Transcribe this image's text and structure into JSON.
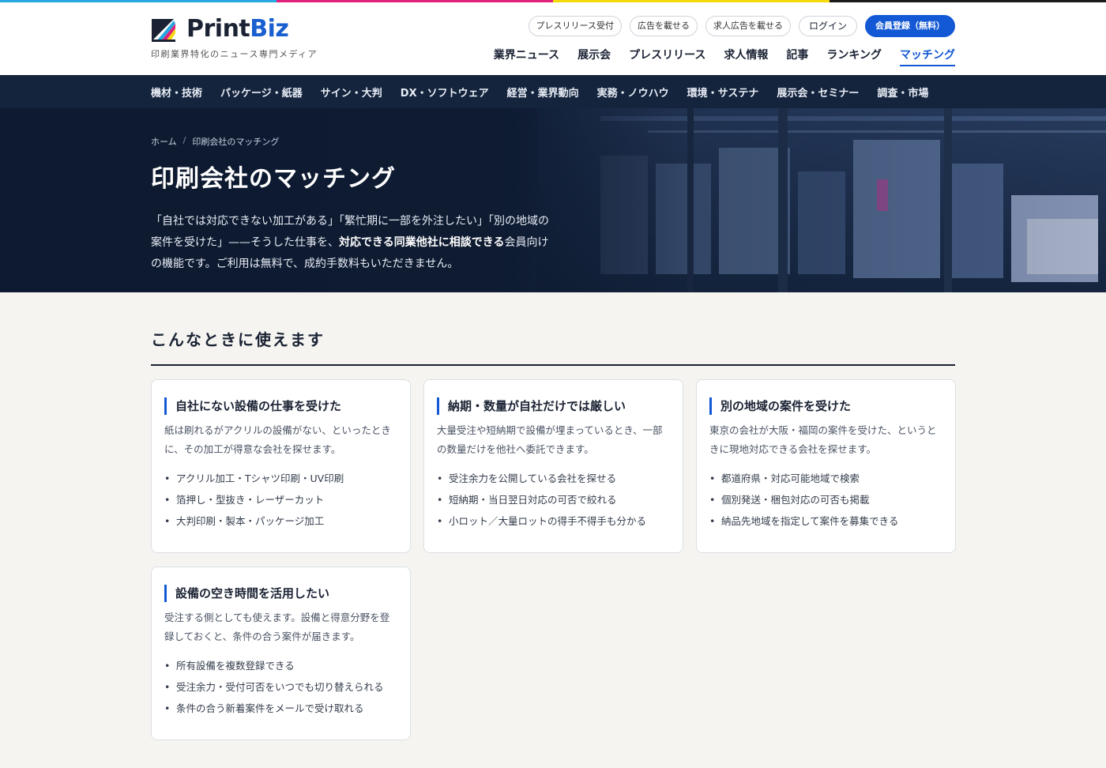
{
  "cmyk_colors": [
    "#27a8e0",
    "#e0207b",
    "#f5d90a",
    "#1a1a1a"
  ],
  "brand": {
    "name_part1": "Print",
    "name_part2": "Biz",
    "tagline": "印刷業界特化のニュース専門メディア",
    "accent": "#1358d4",
    "logo_icon": "printbiz-logo-mark"
  },
  "utility": {
    "press_release": "プレスリリース受付",
    "ads": "広告を載せる",
    "job_ads": "求人広告を載せる",
    "login": "ログイン",
    "register": "会員登録（無料）"
  },
  "main_nav": [
    {
      "label": "業界ニュース",
      "active": false
    },
    {
      "label": "展示会",
      "active": false
    },
    {
      "label": "プレスリリース",
      "active": false
    },
    {
      "label": "求人情報",
      "active": false
    },
    {
      "label": "記事",
      "active": false
    },
    {
      "label": "ランキング",
      "active": false
    },
    {
      "label": "マッチング",
      "active": true
    }
  ],
  "categories": [
    "機材・技術",
    "パッケージ・紙器",
    "サイン・大判",
    "DX・ソフトウェア",
    "経営・業界動向",
    "実務・ノウハウ",
    "環境・サステナ",
    "展示会・セミナー",
    "調査・市場"
  ],
  "hero": {
    "breadcrumb_home": "ホーム",
    "breadcrumb_sep": "/",
    "breadcrumb_current": "印刷会社のマッチング",
    "title": "印刷会社のマッチング",
    "desc_before": "「自社では対応できない加工がある」「繁忙期に一部を外注したい」「別の地域の案件を受けた」——そうした仕事を、",
    "desc_bold": "対応できる同業他社に相談できる",
    "desc_after": "会員向けの機能です。ご利用は無料で、成約手数料もいただきません。"
  },
  "section": {
    "heading": "こんなときに使えます",
    "cards": [
      {
        "title": "自社にない設備の仕事を受けた",
        "desc": "紙は刷れるがアクリルの設備がない、といったときに、その加工が得意な会社を探せます。",
        "items": [
          "アクリル加工・Tシャツ印刷・UV印刷",
          "箔押し・型抜き・レーザーカット",
          "大判印刷・製本・パッケージ加工"
        ]
      },
      {
        "title": "納期・数量が自社だけでは厳しい",
        "desc": "大量受注や短納期で設備が埋まっているとき、一部の数量だけを他社へ委託できます。",
        "items": [
          "受注余力を公開している会社を探せる",
          "短納期・当日翌日対応の可否で絞れる",
          "小ロット／大量ロットの得手不得手も分かる"
        ]
      },
      {
        "title": "別の地域の案件を受けた",
        "desc": "東京の会社が大阪・福岡の案件を受けた、というときに現地対応できる会社を探せます。",
        "items": [
          "都道府県・対応可能地域で検索",
          "個別発送・梱包対応の可否も掲載",
          "納品先地域を指定して案件を募集できる"
        ]
      },
      {
        "title": "設備の空き時間を活用したい",
        "desc": "受注する側としても使えます。設備と得意分野を登録しておくと、条件の合う案件が届きます。",
        "items": [
          "所有設備を複数登録できる",
          "受注余力・受付可否をいつでも切り替えられる",
          "条件の合う新着案件をメールで受け取れる"
        ]
      }
    ]
  }
}
